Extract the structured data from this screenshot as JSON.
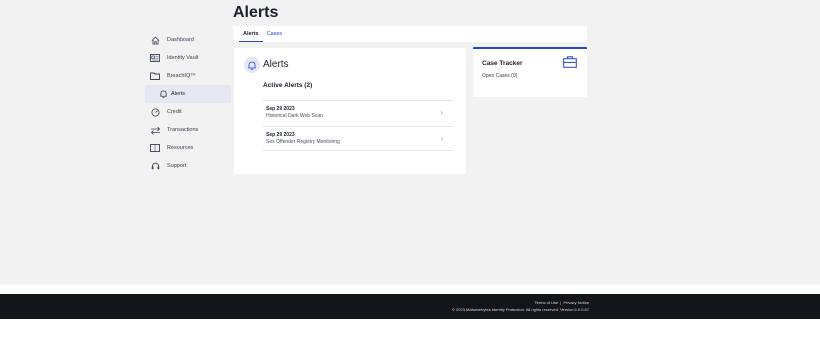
{
  "page": {
    "title": "Alerts"
  },
  "tabs": [
    {
      "label": "Alerts",
      "active": true
    },
    {
      "label": "Cases",
      "active": false
    }
  ],
  "sidebar": {
    "items": [
      {
        "label": "Dashboard",
        "icon": "home-icon"
      },
      {
        "label": "Identity Vault",
        "icon": "id-card-icon"
      },
      {
        "label": "BreachIQ™",
        "icon": "folder-icon"
      },
      {
        "label": "Alerts",
        "icon": "bell-icon",
        "active": true
      },
      {
        "label": "Credit",
        "icon": "gauge-icon"
      },
      {
        "label": "Transactions",
        "icon": "swap-arrows-icon"
      },
      {
        "label": "Resources",
        "icon": "book-icon"
      },
      {
        "label": "Support",
        "icon": "headset-icon"
      }
    ]
  },
  "alerts_card": {
    "title": "Alerts",
    "section_title": "Active Alerts (2)",
    "items": [
      {
        "date": "Sep 29 2023",
        "description": "Historical Dark Web Scan"
      },
      {
        "date": "Sep 29 2023",
        "description": "Sex Offender Registry Monitoring"
      }
    ]
  },
  "case_tracker": {
    "title": "Case Tracker",
    "open_cases": "Open Cases (0)"
  },
  "footer": {
    "terms": "Terms of Use",
    "separator": "|",
    "privacy": "Privacy Notice",
    "copyright": "© 2023 Malwarebytes Identity Protection. All rights reserved. Version 6.0.0.67"
  },
  "colors": {
    "accent": "#2544d8",
    "background": "#f2f2f2",
    "footer": "#141519",
    "active_nav": "#e6e8f3"
  }
}
